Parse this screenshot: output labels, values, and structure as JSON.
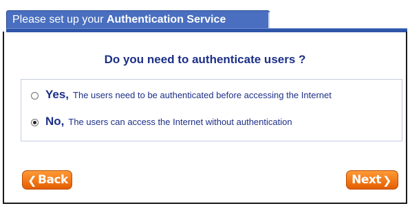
{
  "header": {
    "prefix": "Please set up your ",
    "title_bold": "Authentication Service"
  },
  "question": "Do you need to authenticate users ?",
  "options": [
    {
      "label": "Yes,",
      "description": "The users need to be authenticated before accessing the Internet",
      "selected": false
    },
    {
      "label": "No,",
      "description": "The users can access the Internet without authentication",
      "selected": true
    }
  ],
  "buttons": {
    "back": "Back",
    "next": "Next"
  },
  "icons": {
    "back": "chevron-left-icon",
    "next": "chevron-right-icon"
  },
  "colors": {
    "tab": "#4a6fc0",
    "text": "#1c2f86",
    "button": "#f07a14"
  }
}
